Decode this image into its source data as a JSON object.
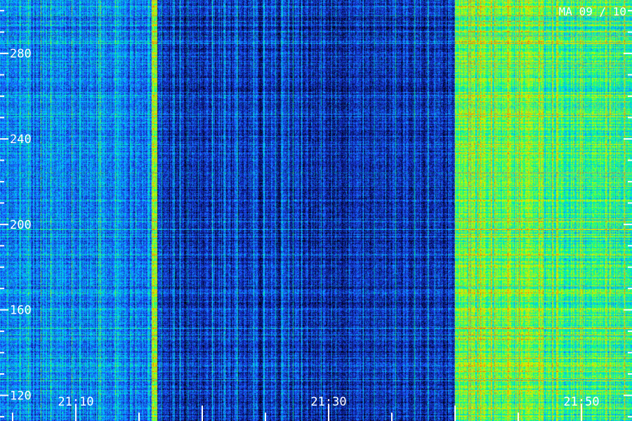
{
  "chart_data": {
    "type": "heatmap",
    "title": "",
    "corner_label": "MA 09 / 10",
    "x_axis": {
      "label": "",
      "unit": "time (HH:MM)",
      "range": [
        "21:04",
        "21:54"
      ],
      "major_ticks": [
        {
          "value": "21:10",
          "label": "21:10"
        },
        {
          "value": "21:30",
          "label": "21:30"
        },
        {
          "value": "21:50",
          "label": "21:50"
        }
      ],
      "minor_tick_spacing_minutes": 5
    },
    "y_axis": {
      "label": "",
      "range": [
        108,
        305
      ],
      "major_ticks": [
        120,
        160,
        200,
        240,
        280
      ],
      "minor_tick_spacing": 10
    },
    "colormap": [
      "#000000",
      "#0a1a8c",
      "#1e50ff",
      "#00c8ff",
      "#00ff90",
      "#b4ff00",
      "#ffd200",
      "#ff5a00"
    ],
    "intensity_regions": [
      {
        "time_range": [
          "21:04",
          "21:16"
        ],
        "level": 0.32,
        "description_bands": "moderate blue"
      },
      {
        "time_range": [
          "21:16",
          "21:16.4"
        ],
        "level": 0.72,
        "description_bands": "bright green vertical stripe"
      },
      {
        "time_range": [
          "21:16.4",
          "21:40"
        ],
        "level": 0.18,
        "description_bands": "dark blue"
      },
      {
        "time_range": [
          "21:40",
          "21:47"
        ],
        "level": 0.62,
        "description_bands": "cyan/green, yellow near top"
      },
      {
        "time_range": [
          "21:47",
          "21:54"
        ],
        "level": 0.55,
        "description_bands": "cyan/green, orange near 275"
      }
    ],
    "grid": false,
    "legend": "none"
  }
}
